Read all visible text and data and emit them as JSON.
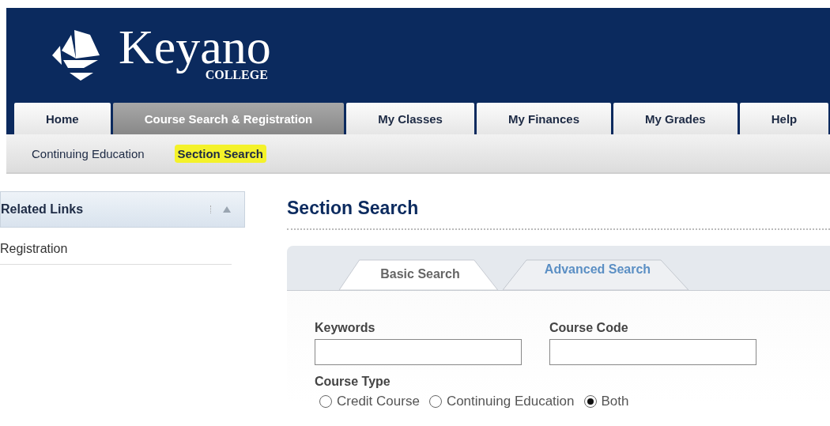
{
  "logo": {
    "name": "Keyano",
    "subtitle": "COLLEGE"
  },
  "tabs": [
    {
      "label": "Home",
      "selected": false
    },
    {
      "label": "Course Search & Registration",
      "selected": true
    },
    {
      "label": "My Classes",
      "selected": false
    },
    {
      "label": "My Finances",
      "selected": false
    },
    {
      "label": "My Grades",
      "selected": false
    },
    {
      "label": "Help",
      "selected": false
    }
  ],
  "subnav": [
    {
      "label": "Continuing Education",
      "selected": false
    },
    {
      "label": "Section Search",
      "selected": true
    }
  ],
  "sidebar": {
    "title": "Related Links",
    "expanded": true,
    "links": [
      "Registration"
    ]
  },
  "page_title": "Section Search",
  "search_tabs": [
    {
      "label": "Basic Search",
      "selected": true
    },
    {
      "label": "Advanced Search",
      "selected": false
    }
  ],
  "fields": [
    {
      "label": "Keywords"
    },
    {
      "label": "Course Code"
    }
  ],
  "course_type": {
    "label": "Course Type",
    "options": [
      {
        "label": "Credit Course",
        "selected": false
      },
      {
        "label": "Continuing Education",
        "selected": false
      },
      {
        "label": "Both",
        "selected": true
      }
    ]
  }
}
